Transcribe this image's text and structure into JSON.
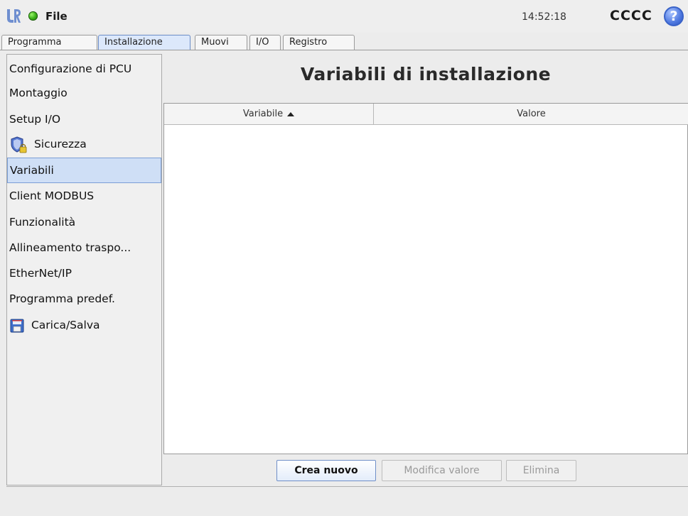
{
  "header": {
    "file_label": "File",
    "clock": "14:52:18",
    "robot_name": "CCCC",
    "help_glyph": "?"
  },
  "tabs": [
    {
      "label": "Programma",
      "active": false
    },
    {
      "label": "Installazione",
      "active": true
    },
    {
      "label": "Muovi",
      "active": false
    },
    {
      "label": "I/O",
      "active": false
    },
    {
      "label": "Registro",
      "active": false
    }
  ],
  "sidebar": {
    "items": [
      {
        "label": "Configurazione di PCU",
        "icon": null,
        "selected": false
      },
      {
        "label": "Montaggio",
        "icon": null,
        "selected": false
      },
      {
        "label": "Setup I/O",
        "icon": null,
        "selected": false
      },
      {
        "label": "Sicurezza",
        "icon": "shield-lock-icon",
        "selected": false
      },
      {
        "label": "Variabili",
        "icon": null,
        "selected": true
      },
      {
        "label": "Client MODBUS",
        "icon": null,
        "selected": false
      },
      {
        "label": "Funzionalità",
        "icon": null,
        "selected": false
      },
      {
        "label": "Allineamento traspo...",
        "icon": null,
        "selected": false
      },
      {
        "label": "EtherNet/IP",
        "icon": null,
        "selected": false
      },
      {
        "label": "Programma predef.",
        "icon": null,
        "selected": false
      },
      {
        "label": "Carica/Salva",
        "icon": "floppy-disk-icon",
        "selected": false
      }
    ]
  },
  "main": {
    "title": "Variabili di installazione",
    "table": {
      "columns": [
        "Variabile",
        "Valore"
      ],
      "sorted_column": "Variabile",
      "rows": []
    },
    "buttons": {
      "create": "Crea nuovo",
      "edit": "Modifica valore",
      "delete": "Elimina"
    }
  },
  "colors": {
    "accent": "#3a63c8",
    "selection": "#cfdff6",
    "status_ok": "#3fb51c"
  }
}
